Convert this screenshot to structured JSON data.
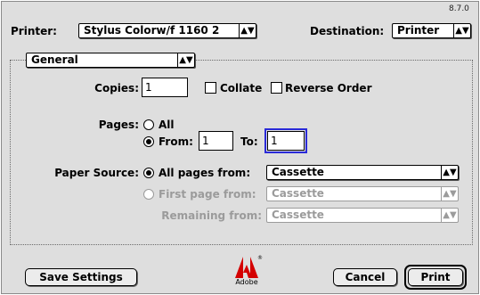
{
  "version": "8.7.0",
  "printer": {
    "label": "Printer:",
    "value": "Stylus Colorw/f 1160 2"
  },
  "destination": {
    "label": "Destination:",
    "value": "Printer"
  },
  "panel": {
    "value": "General"
  },
  "copies": {
    "label": "Copies:",
    "value": "1"
  },
  "collate": {
    "label": "Collate",
    "checked": false
  },
  "reverse_order": {
    "label": "Reverse Order",
    "checked": false
  },
  "pages": {
    "label": "Pages:",
    "all_label": "All",
    "from_label": "From:",
    "from_value": "1",
    "to_label": "To:",
    "to_value": "1",
    "selected": "from"
  },
  "paper_source": {
    "label": "Paper Source:",
    "all_pages_label": "All pages from:",
    "all_pages_value": "Cassette",
    "first_page_label": "First page from:",
    "first_page_value": "Cassette",
    "remaining_label": "Remaining from:",
    "remaining_value": "Cassette",
    "selected": "all"
  },
  "buttons": {
    "save_settings": "Save Settings",
    "cancel": "Cancel",
    "print": "Print"
  },
  "adobe": {
    "wordmark": "Adobe",
    "registered": "®"
  },
  "icons": {
    "popup_arrow": "updown-arrow-icon",
    "adobe_logo": "adobe-logo-icon"
  }
}
